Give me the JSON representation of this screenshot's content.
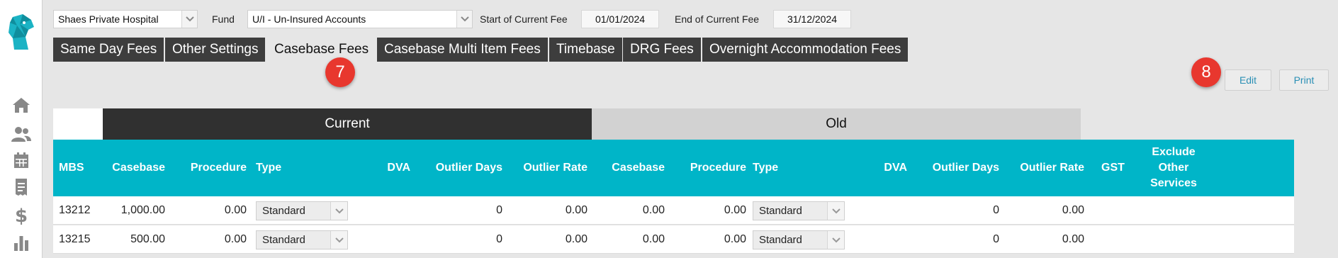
{
  "sidebar": {
    "nav": [
      {
        "icon": "home-icon"
      },
      {
        "icon": "users-icon"
      },
      {
        "icon": "calendar-icon"
      },
      {
        "icon": "receipt-icon"
      },
      {
        "icon": "dollar-icon"
      },
      {
        "icon": "bar-chart-icon"
      }
    ]
  },
  "filters": {
    "hospital": "Shaes Private Hospital",
    "fund_label": "Fund",
    "fund": "U/I - Un-Insured Accounts",
    "start_label": "Start of Current Fee",
    "start_date": "01/01/2024",
    "end_label": "End of Current Fee",
    "end_date": "31/12/2024"
  },
  "tabs": [
    {
      "label": "Same Day Fees",
      "active": false
    },
    {
      "label": "Other Settings",
      "active": false
    },
    {
      "label": "Casebase Fees",
      "active": true
    },
    {
      "label": "Casebase Multi Item Fees",
      "active": false
    },
    {
      "label": "Timebase",
      "active": false
    },
    {
      "label": "DRG Fees",
      "active": false
    },
    {
      "label": "Overnight Accommodation Fees",
      "active": false
    }
  ],
  "badges": {
    "tab_badge": "7",
    "edit_badge": "8"
  },
  "actions": {
    "edit": "Edit",
    "print": "Print"
  },
  "table": {
    "group_current": "Current",
    "group_old": "Old",
    "headers": {
      "mbs": "MBS",
      "casebase": "Casebase",
      "procedure": "Procedure",
      "type": "Type",
      "dva": "DVA",
      "outlier_days": "Outlier Days",
      "outlier_rate": "Outlier Rate",
      "old_casebase": "Casebase",
      "old_procedure": "Procedure",
      "old_type": "Type",
      "old_dva": "DVA",
      "old_outlier_days": "Outlier Days",
      "old_outlier_rate": "Outlier Rate",
      "gst": "GST",
      "exclude": "Exclude Other Services"
    },
    "rows": [
      {
        "mbs": "13212",
        "casebase": "1,000.00",
        "procedure": "0.00",
        "type": "Standard",
        "outlier_days": "0",
        "outlier_rate": "0.00",
        "old_casebase": "0.00",
        "old_procedure": "0.00",
        "old_type": "Standard",
        "old_outlier_days": "0",
        "old_outlier_rate": "0.00"
      },
      {
        "mbs": "13215",
        "casebase": "500.00",
        "procedure": "0.00",
        "type": "Standard",
        "outlier_days": "0",
        "outlier_rate": "0.00",
        "old_casebase": "0.00",
        "old_procedure": "0.00",
        "old_type": "Standard",
        "old_outlier_days": "0",
        "old_outlier_rate": "0.00"
      }
    ]
  },
  "colors": {
    "accent": "#00b5c8",
    "tab_bg": "#3d3d3d",
    "badge": "#e8372e",
    "link": "#2a8fb5"
  }
}
